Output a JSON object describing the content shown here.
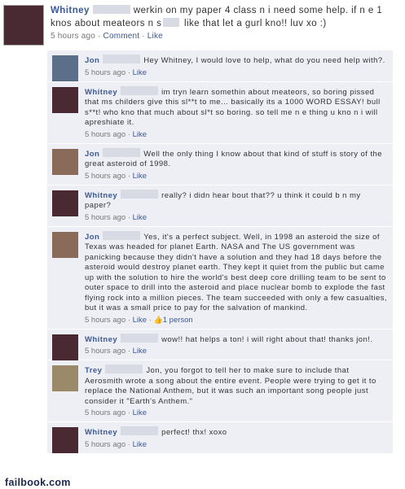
{
  "status": {
    "author": "Whitney",
    "text_part1": "werkin on my paper 4 class n i need some help. if n e 1 knos about meateors n s",
    "text_part2": " like that let a gurl kno!! luv xo :)",
    "time": "5 hours ago",
    "sep": "·",
    "comment_link": "Comment",
    "like_link": "Like"
  },
  "comments": [
    {
      "author": "Jon",
      "text": "Hey Whitney, I would love to help, what do you need help with?.",
      "time": "5 hours ago",
      "like_link": "Like",
      "avatar_color": "#5b6e8a"
    },
    {
      "author": "Whitney",
      "text": "im tryn learn somethin about meateors, so boring pissed that ms childers give this sl**t to me... basically its a 1000 WORD ESSAY! bull s**t! who kno that much about sl*t so boring. so tell me n e thing u kno n i will apreshiate it.",
      "time": "5 hours ago",
      "like_link": "Like",
      "avatar_color": "#4a2a32"
    },
    {
      "author": "Jon",
      "text": "Well the only thing I know about that kind of stuff is story of the great asteroid of 1998.",
      "time": "5 hours ago",
      "like_link": "Like",
      "avatar_color": "#8a6a58"
    },
    {
      "author": "Whitney",
      "text": "really? i didn hear bout that?? u think it could b n my paper?",
      "time": "5 hours ago",
      "like_link": "Like",
      "avatar_color": "#4a2a32"
    },
    {
      "author": "Jon",
      "text": "Yes, it's a perfect subject. Well, in 1998 an asteroid the size of Texas was headed for planet Earth. NASA and The US government was panicking because they didn't have a solution and they had 18 days before the asteroid would destroy planet earth. They kept it quiet from the public but came up with the solution to hire the world's best deep core drilling team to be sent to outer space to drill into the asteroid and place nuclear bomb to explode the fast flying rock into a million pieces. The team succeeded with only a few casualties, but it was a small price to pay for the salvation of mankind.",
      "time": "5 hours ago",
      "like_link": "Like",
      "likes": "1 person",
      "avatar_color": "#8a6a58"
    },
    {
      "author": "Whitney",
      "text": "wow!! hat helps a ton! i will right about that! thanks jon!.",
      "time": "5 hours ago",
      "like_link": "Like",
      "avatar_color": "#4a2a32"
    },
    {
      "author": "Trey",
      "text": "Jon, you forgot to tell her to make sure to include that Aerosmith wrote a song about the entire event. People were trying to get it to replace the National Anthem, but it was such an important song people just consider it \"Earth's Anthem.\"",
      "time": "5 hours ago",
      "like_link": "Like",
      "avatar_color": "#9a8a6a"
    },
    {
      "author": "Whitney",
      "text": "perfect! thx! xoxo",
      "time": "5 hours ago",
      "like_link": "Like",
      "avatar_color": "#4a2a32"
    }
  ],
  "watermark": "failbook.com"
}
